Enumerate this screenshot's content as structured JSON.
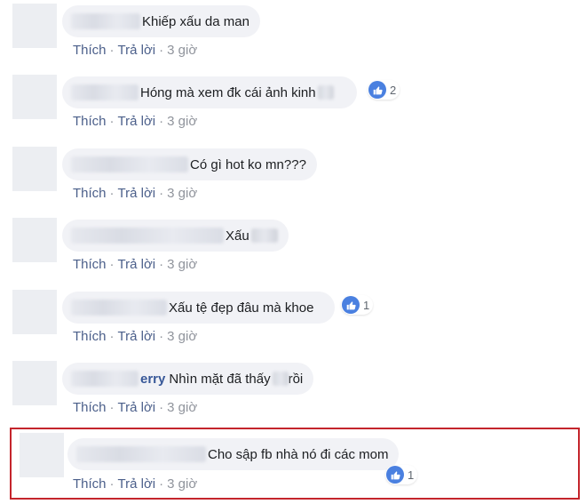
{
  "actions": {
    "like": "Thích",
    "reply": "Trả lời",
    "separator": "·"
  },
  "colors": {
    "highlight_border": "#c4252c",
    "like_icon": "#4a80e0",
    "action_link": "#4b5f8a"
  },
  "comments": [
    {
      "name_visible": "",
      "text": "Khiếp xấu da man",
      "time": "3 giờ",
      "likes": ""
    },
    {
      "name_visible": "",
      "text": "Hóng mà xem đk cái ảnh kinh",
      "time": "3 giờ",
      "likes": "2"
    },
    {
      "name_visible": "",
      "text": "Có gì hot ko mn???",
      "time": "3 giờ",
      "likes": ""
    },
    {
      "name_visible": "",
      "text": "Xấu",
      "time": "3 giờ",
      "likes": ""
    },
    {
      "name_visible": "",
      "text": "Xấu tệ đẹp đâu mà khoe",
      "time": "3 giờ",
      "likes": "1"
    },
    {
      "name_visible": "erry",
      "text": "Nhìn mặt đã thấy",
      "text_after": "rồi",
      "time": "3 giờ",
      "likes": ""
    },
    {
      "name_visible": "",
      "text": "Cho sập fb nhà nó đi các mom",
      "time": "3 giờ",
      "likes": "1",
      "highlighted": true
    }
  ]
}
